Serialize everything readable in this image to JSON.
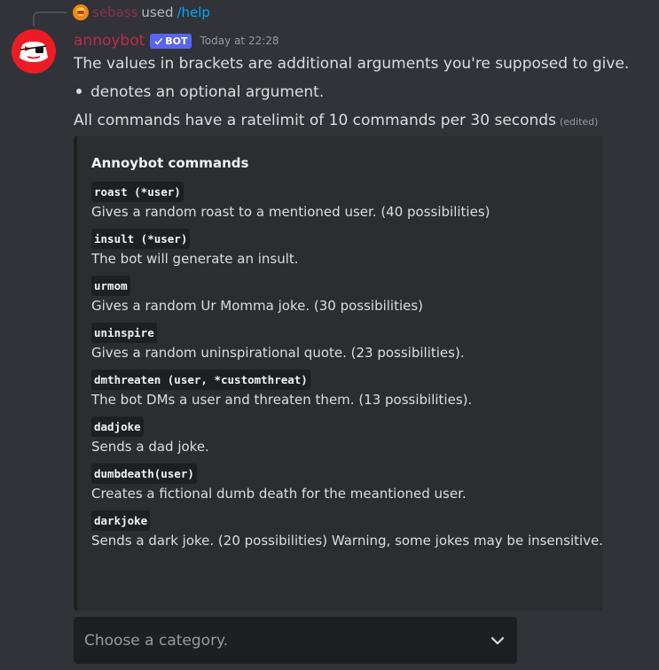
{
  "interaction": {
    "user": "sebass",
    "used": "used",
    "command": "/help"
  },
  "message": {
    "author": "annoybot",
    "bot_tag": "BOT",
    "timestamp": "Today at 22:28",
    "line1": "The values in brackets are additional arguments you're supposed to give.",
    "bullet": "denotes an optional argument.",
    "line3": "All commands have a ratelimit of 10 commands per 30 seconds",
    "edited": "(edited)"
  },
  "embed": {
    "title": "Annoybot commands",
    "fields": [
      {
        "code": "roast (*user)",
        "desc": "Gives a random roast to a mentioned user. (40 possibilities)"
      },
      {
        "code": "insult (*user)",
        "desc": "The bot will generate an insult."
      },
      {
        "code": "urmom",
        "desc": "Gives a random Ur Momma joke. (30 possibilities)"
      },
      {
        "code": "uninspire",
        "desc": "Gives a random uninspirational quote. (23 possibilities)."
      },
      {
        "code": "dmthreaten (user, *customthreat)",
        "desc": "The bot DMs a user and threaten them. (13 possibilities)."
      },
      {
        "code": "dadjoke",
        "desc": "Sends a dad joke."
      },
      {
        "code": "dumbdeath(user)",
        "desc": "Creates a fictional dumb death for the meantioned user."
      },
      {
        "code": "darkjoke",
        "desc": "Sends a dark joke. (20 possibilities) Warning, some jokes may be insensitive."
      }
    ]
  },
  "select": {
    "placeholder": "Choose a category."
  },
  "colors": {
    "background": "#313338",
    "embed_bg": "#2b2d31",
    "username": "#be2d4c",
    "bot_tag": "#5865f2",
    "command_link": "#00a8fc",
    "avatar": "#ed1c24"
  },
  "icons": {
    "avatar": "annoybot-avatar-icon",
    "verified": "checkmark-icon",
    "dropdown": "chevron-down-icon"
  }
}
